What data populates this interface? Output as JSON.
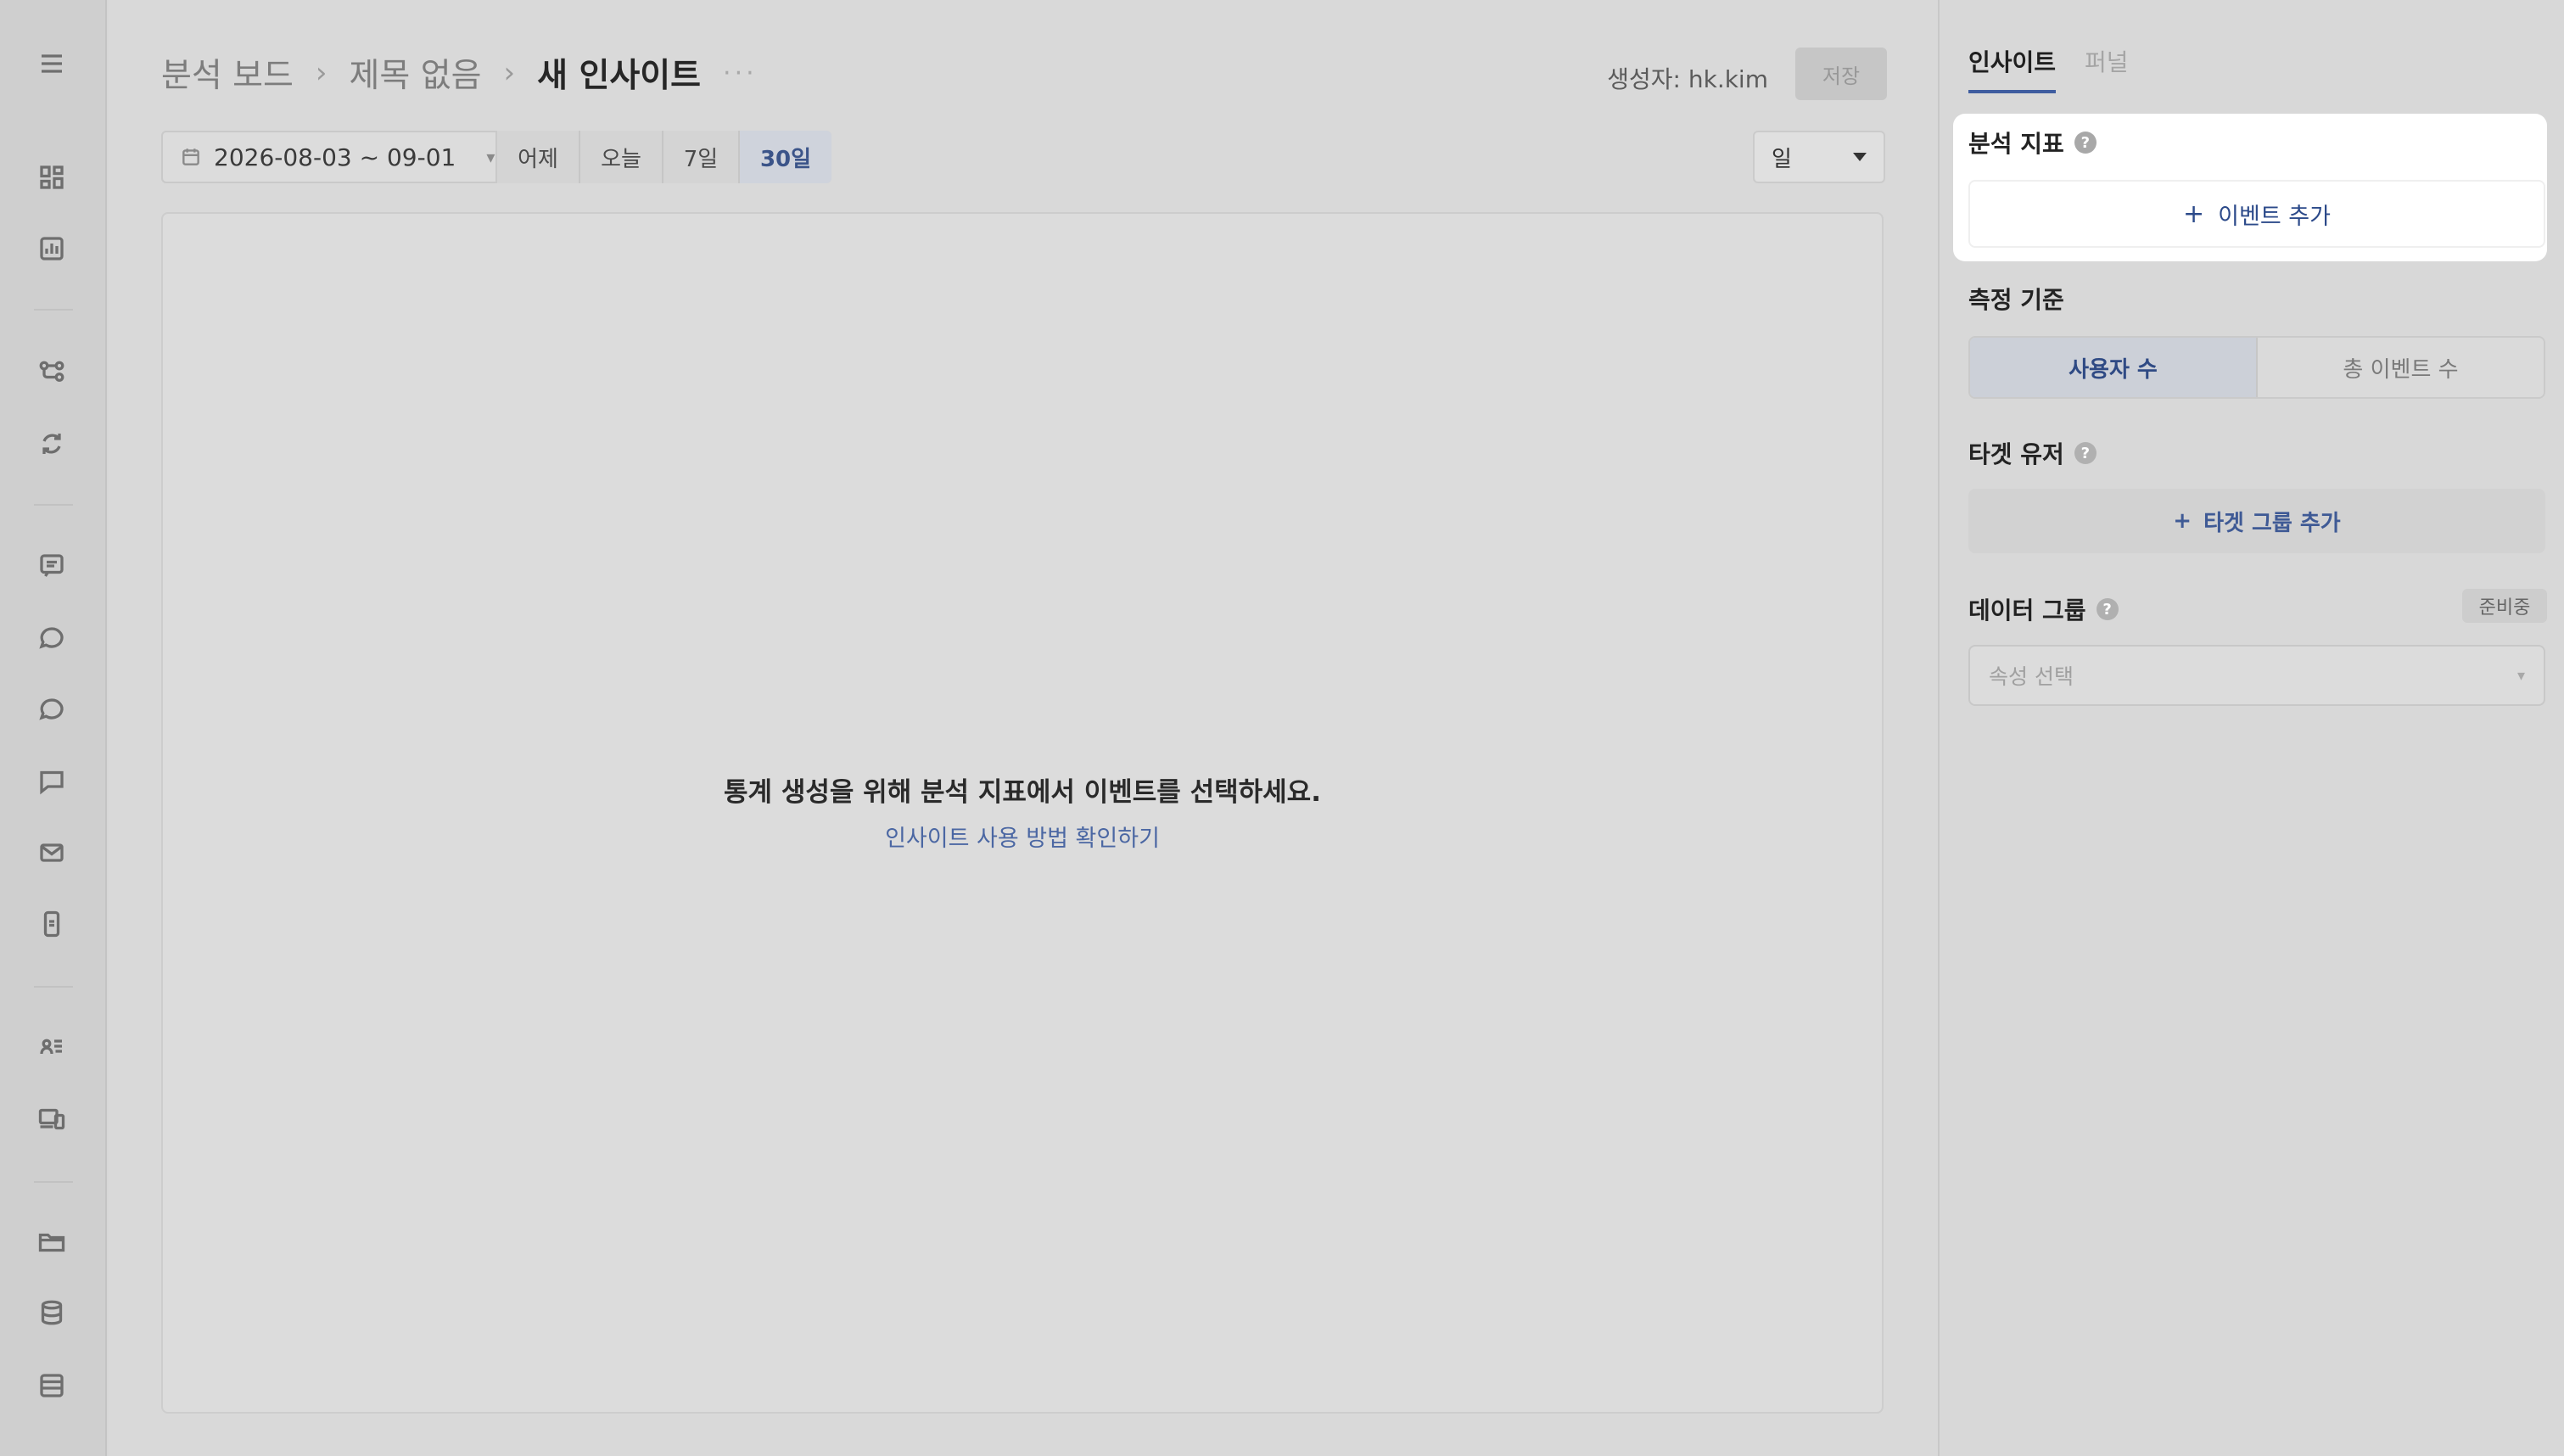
{
  "header": {
    "breadcrumb": [
      "분석 보드",
      "제목 없음",
      "새 인사이트"
    ],
    "more": "···",
    "creator_label": "생성자:",
    "creator_name": "hk.kim",
    "save_label": "저장"
  },
  "filters": {
    "date_range": "2026-08-03 ~ 09-01",
    "presets": [
      "어제",
      "오늘",
      "7일",
      "30일"
    ],
    "active_preset": "30일",
    "granularity": "일"
  },
  "chart": {
    "empty_message": "통계 생성을 위해 분석 지표에서 이벤트를 선택하세요.",
    "help_link": "인사이트 사용 방법 확인하기"
  },
  "panel": {
    "tabs": [
      "인사이트",
      "퍼널"
    ],
    "active_tab": "인사이트",
    "metric": {
      "title": "분석 지표",
      "add_event": "이벤트 추가"
    },
    "measure": {
      "title": "측정 기준",
      "options": [
        "사용자 수",
        "총 이벤트 수"
      ]
    },
    "target": {
      "title": "타겟 유저",
      "add_group": "타겟 그룹 추가"
    },
    "data_group": {
      "title": "데이터 그룹",
      "badge": "준비중",
      "placeholder": "속성 선택"
    }
  },
  "rail_icons": [
    "menu-icon",
    "dashboard-icon",
    "report-icon",
    "flow-icon",
    "refresh-icon",
    "message-board-icon",
    "chat-icon",
    "chat-bubble-icon",
    "chat-dots-icon",
    "mail-icon",
    "mobile-icon",
    "user-list-icon",
    "devices-icon",
    "folder-icon",
    "database-icon",
    "table-icon"
  ]
}
